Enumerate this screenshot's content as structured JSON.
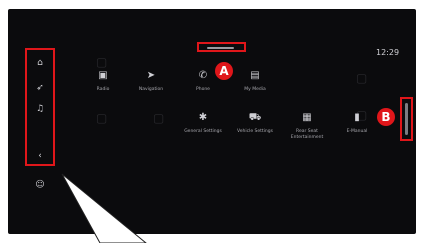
{
  "status": {
    "clock": "12:29"
  },
  "callouts": {
    "a": "A",
    "b": "B"
  },
  "sidebar": {
    "items": [
      {
        "name": "home",
        "glyph": "⌂"
      },
      {
        "name": "navigation",
        "glyph": "➶"
      },
      {
        "name": "music",
        "glyph": "♫"
      },
      {
        "name": "back",
        "glyph": "‹"
      }
    ],
    "extra_icon": {
      "name": "user",
      "glyph": "☺"
    }
  },
  "apps": {
    "row1": [
      {
        "label": "Radio",
        "icon": "radio-icon",
        "glyph": "▣"
      },
      {
        "label": "Navigation",
        "icon": "navigation-arrow-icon",
        "glyph": "➤"
      },
      {
        "label": "Phone",
        "icon": "phone-icon",
        "glyph": "✆"
      },
      {
        "label": "My Media",
        "icon": "media-icon",
        "glyph": "▤"
      }
    ],
    "row2": [
      {
        "label": "General Settings",
        "icon": "gear-icon",
        "glyph": "✱"
      },
      {
        "label": "Vehicle Settings",
        "icon": "car-icon",
        "glyph": "⛟"
      },
      {
        "label": "Rear Seat Entertainment",
        "icon": "seat-icon",
        "glyph": "▦"
      },
      {
        "label": "E-Manual",
        "icon": "book-icon",
        "glyph": "▮"
      }
    ]
  },
  "colors": {
    "highlight": "#e0161a",
    "screen": "#0b0b0d",
    "text": "#cfcfd4"
  }
}
